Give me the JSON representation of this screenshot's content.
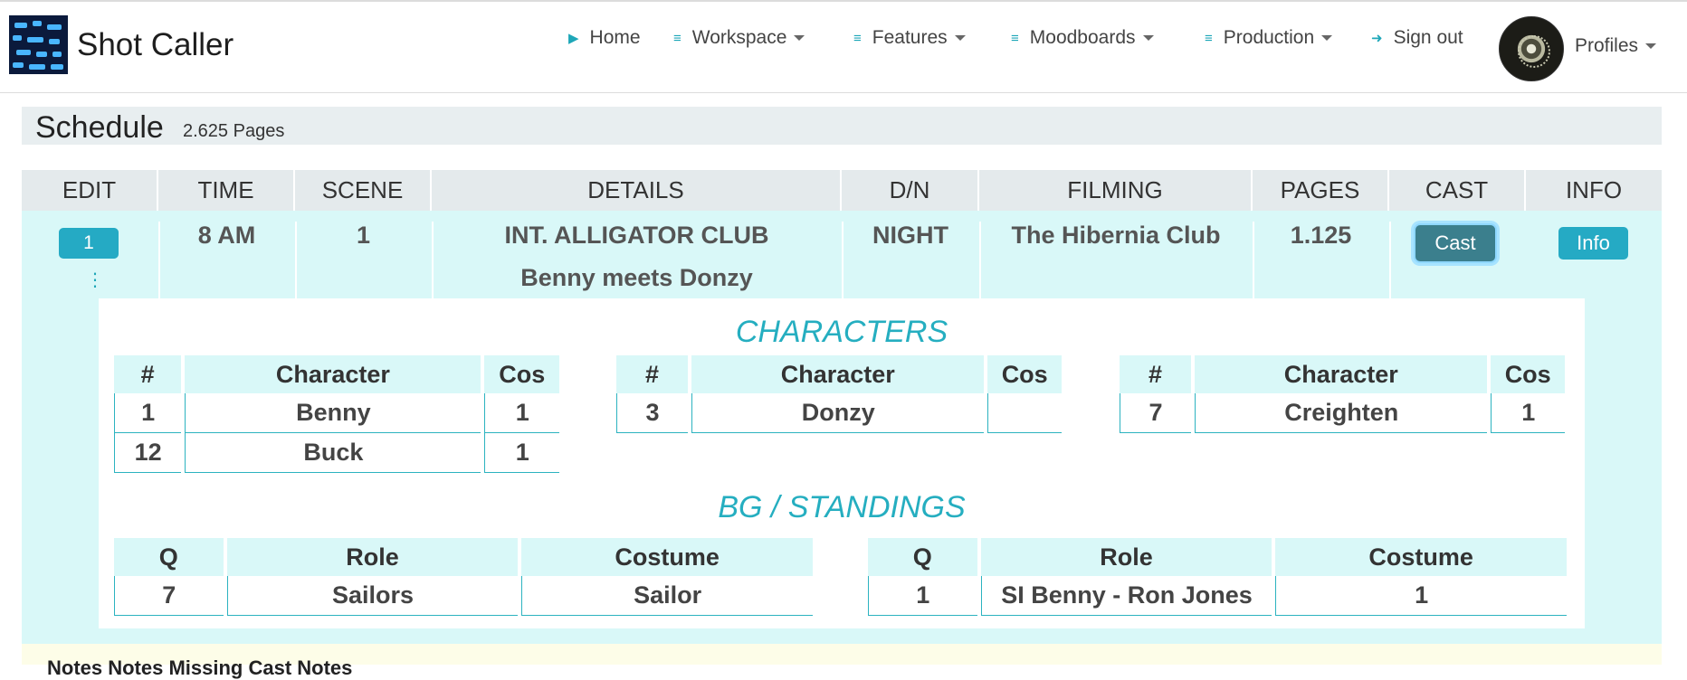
{
  "app": {
    "title": "Shot Caller"
  },
  "nav": {
    "home": "Home",
    "workspace": "Workspace",
    "features": "Features",
    "moodboards": "Moodboards",
    "production": "Production",
    "signout": "Sign out",
    "profiles": "Profiles"
  },
  "schedule": {
    "title": "Schedule",
    "pages": "2.625 Pages"
  },
  "columns": [
    "EDIT",
    "TIME",
    "SCENE",
    "DETAILS",
    "D/N",
    "FILMING",
    "PAGES",
    "CAST",
    "INFO"
  ],
  "row": {
    "edit_number": "1",
    "time": "8 AM",
    "scene": "1",
    "details_line1": "INT. ALLIGATOR CLUB",
    "details_line2": "Benny meets Donzy",
    "dn": "NIGHT",
    "filming": "The Hibernia Club",
    "pages": "1.125",
    "cast_button": "Cast",
    "info_button": "Info"
  },
  "characters": {
    "title": "CHARACTERS",
    "headers": [
      "#",
      "Character",
      "Cos"
    ],
    "tables": [
      [
        {
          "num": "1",
          "name": "Benny",
          "cos": "1"
        },
        {
          "num": "12",
          "name": "Buck",
          "cos": "1"
        }
      ],
      [
        {
          "num": "3",
          "name": "Donzy",
          "cos": ""
        }
      ],
      [
        {
          "num": "7",
          "name": "Creighten",
          "cos": "1"
        }
      ]
    ]
  },
  "bg": {
    "title": "BG / STANDINGS",
    "headers": [
      "Q",
      "Role",
      "Costume"
    ],
    "tables": [
      [
        {
          "q": "7",
          "role": "Sailors",
          "costume": "Sailor"
        }
      ],
      [
        {
          "q": "1",
          "role": "SI Benny - Ron Jones",
          "costume": "1"
        }
      ]
    ]
  },
  "notes": {
    "text": "Notes Notes Missing Cast Notes"
  },
  "colors": {
    "accent": "#25aac4",
    "row_bg": "#d9f8f8",
    "header_bg": "#e4eaec",
    "cast_button": "#3b7f8d"
  }
}
